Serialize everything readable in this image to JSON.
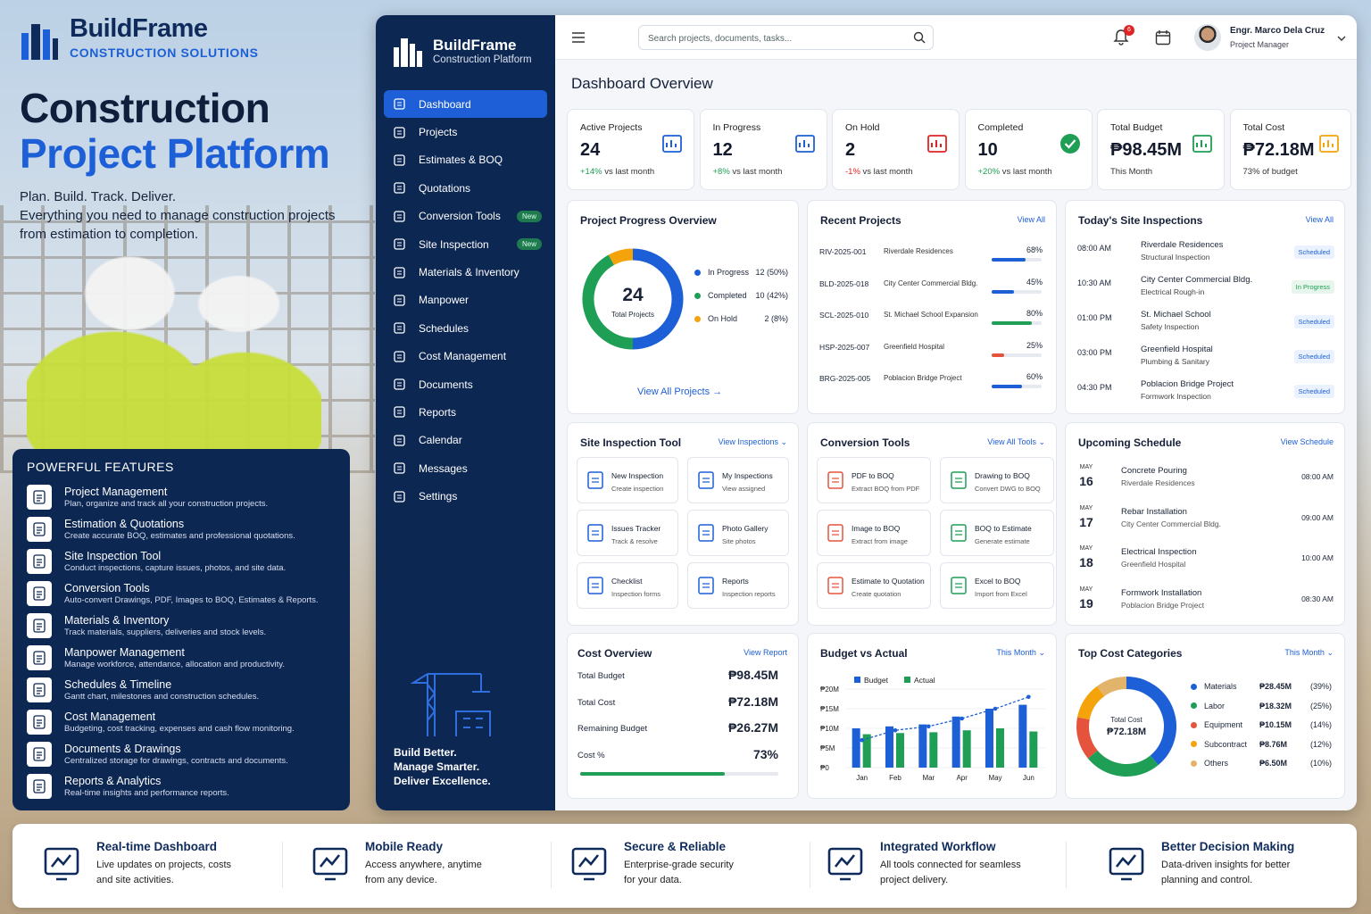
{
  "brand": {
    "name": "BuildFrame",
    "tagline": "CONSTRUCTION SOLUTIONS"
  },
  "hero": {
    "line1": "Construction",
    "line2": "Project Platform",
    "tag": "Plan. Build. Track. Deliver.",
    "desc": "Everything you need to manage construction projects from estimation to completion."
  },
  "features": {
    "title": "POWERFUL FEATURES",
    "items": [
      {
        "title": "Project Management",
        "desc": "Plan, organize and track all your construction projects."
      },
      {
        "title": "Estimation & Quotations",
        "desc": "Create accurate BOQ, estimates and professional quotations."
      },
      {
        "title": "Site Inspection Tool",
        "desc": "Conduct inspections, capture issues, photos, and site data."
      },
      {
        "title": "Conversion Tools",
        "desc": "Auto-convert Drawings, PDF, Images to BOQ, Estimates & Reports."
      },
      {
        "title": "Materials & Inventory",
        "desc": "Track materials, suppliers, deliveries and stock levels."
      },
      {
        "title": "Manpower Management",
        "desc": "Manage workforce, attendance, allocation and productivity."
      },
      {
        "title": "Schedules & Timeline",
        "desc": "Gantt chart, milestones and construction schedules."
      },
      {
        "title": "Cost Management",
        "desc": "Budgeting, cost tracking, expenses and cash flow monitoring."
      },
      {
        "title": "Documents & Drawings",
        "desc": "Centralized storage for drawings, contracts and documents."
      },
      {
        "title": "Reports & Analytics",
        "desc": "Real-time insights and performance reports."
      }
    ]
  },
  "sidebar": {
    "title": "BuildFrame",
    "subtitle": "Construction Platform",
    "badge": "New",
    "items": [
      {
        "label": "Dashboard",
        "icon": "home-icon"
      },
      {
        "label": "Projects",
        "icon": "folder-icon"
      },
      {
        "label": "Estimates & BOQ",
        "icon": "calculator-icon"
      },
      {
        "label": "Quotations",
        "icon": "document-icon"
      },
      {
        "label": "Conversion Tools",
        "icon": "convert-icon"
      },
      {
        "label": "Site Inspection",
        "icon": "clipboard-icon"
      },
      {
        "label": "Materials & Inventory",
        "icon": "box-icon"
      },
      {
        "label": "Manpower",
        "icon": "users-icon"
      },
      {
        "label": "Schedules",
        "icon": "calendar-icon"
      },
      {
        "label": "Cost Management",
        "icon": "coins-icon"
      },
      {
        "label": "Documents",
        "icon": "file-icon"
      },
      {
        "label": "Reports",
        "icon": "chart-icon"
      },
      {
        "label": "Calendar",
        "icon": "calendar-icon"
      },
      {
        "label": "Messages",
        "icon": "message-icon"
      },
      {
        "label": "Settings",
        "icon": "gear-icon"
      }
    ],
    "footer": [
      "Build Better.",
      "Manage Smarter.",
      "Deliver Excellence."
    ]
  },
  "topbar": {
    "search_placeholder": "Search projects, documents, tasks...",
    "notifications": "6",
    "user_name": "Engr. Marco Dela Cruz",
    "user_role": "Project Manager"
  },
  "page_title": "Dashboard Overview",
  "kpis": [
    {
      "label": "Active Projects",
      "value": "24",
      "delta": "+14%",
      "suffix": "vs last month",
      "tone": "green"
    },
    {
      "label": "In Progress",
      "value": "12",
      "delta": "+8%",
      "suffix": "vs last month",
      "tone": "green"
    },
    {
      "label": "On Hold",
      "value": "2",
      "delta": "-1%",
      "suffix": "vs last month",
      "tone": "red"
    },
    {
      "label": "Completed",
      "value": "10",
      "delta": "+20%",
      "suffix": "vs last month",
      "tone": "green"
    },
    {
      "label": "Total Budget",
      "value": "₱98.45M",
      "delta": "",
      "suffix": "This Month",
      "tone": ""
    },
    {
      "label": "Total Cost",
      "value": "₱72.18M",
      "delta": "",
      "suffix": "73% of budget",
      "tone": ""
    }
  ],
  "progress": {
    "title": "Project Progress Overview",
    "center_value": "24",
    "center_label": "Total Projects",
    "link": "View All Projects →",
    "legend": [
      {
        "label": "In Progress",
        "value": "12 (50%)",
        "color": "#1d5fd6"
      },
      {
        "label": "Completed",
        "value": "10 (42%)",
        "color": "#1f9e55"
      },
      {
        "label": "On Hold",
        "value": "2 (8%)",
        "color": "#f5a30a"
      }
    ]
  },
  "recent": {
    "title": "Recent Projects",
    "link": "View All",
    "rows": [
      {
        "code": "RIV-2025-001",
        "name": "Riverdale Residences",
        "pct": "68%",
        "frac": 0.68,
        "color": "#1d5fd6"
      },
      {
        "code": "BLD-2025-018",
        "name": "City Center Commercial Bldg.",
        "pct": "45%",
        "frac": 0.45,
        "color": "#1d5fd6"
      },
      {
        "code": "SCL-2025-010",
        "name": "St. Michael School Expansion",
        "pct": "80%",
        "frac": 0.8,
        "color": "#1f9e55"
      },
      {
        "code": "HSP-2025-007",
        "name": "Greenfield Hospital",
        "pct": "25%",
        "frac": 0.25,
        "color": "#e5533d"
      },
      {
        "code": "BRG-2025-005",
        "name": "Poblacion Bridge Project",
        "pct": "60%",
        "frac": 0.6,
        "color": "#1d5fd6"
      }
    ]
  },
  "inspections": {
    "title": "Today's Site Inspections",
    "link": "View All",
    "rows": [
      {
        "time": "08:00 AM",
        "name": "Riverdale Residences",
        "type": "Structural Inspection",
        "status": "Scheduled",
        "green": false
      },
      {
        "time": "10:30 AM",
        "name": "City Center Commercial Bldg.",
        "type": "Electrical Rough-in",
        "status": "In Progress",
        "green": true
      },
      {
        "time": "01:00 PM",
        "name": "St. Michael School",
        "type": "Safety Inspection",
        "status": "Scheduled",
        "green": false
      },
      {
        "time": "03:00 PM",
        "name": "Greenfield Hospital",
        "type": "Plumbing & Sanitary",
        "status": "Scheduled",
        "green": false
      },
      {
        "time": "04:30 PM",
        "name": "Poblacion Bridge Project",
        "type": "Formwork Inspection",
        "status": "Scheduled",
        "green": false
      }
    ]
  },
  "site_tool": {
    "title": "Site Inspection Tool",
    "link": "View Inspections",
    "tiles": [
      {
        "title": "New Inspection",
        "desc": "Create inspection"
      },
      {
        "title": "My Inspections",
        "desc": "View assigned"
      },
      {
        "title": "Issues Tracker",
        "desc": "Track & resolve"
      },
      {
        "title": "Photo Gallery",
        "desc": "Site photos"
      },
      {
        "title": "Checklist",
        "desc": "Inspection forms"
      },
      {
        "title": "Reports",
        "desc": "Inspection reports"
      }
    ]
  },
  "conversion": {
    "title": "Conversion Tools",
    "link": "View All Tools",
    "tiles": [
      {
        "title": "PDF to BOQ",
        "desc": "Extract BOQ from PDF"
      },
      {
        "title": "Drawing to BOQ",
        "desc": "Convert DWG to BOQ"
      },
      {
        "title": "Image to BOQ",
        "desc": "Extract from image"
      },
      {
        "title": "BOQ to Estimate",
        "desc": "Generate estimate"
      },
      {
        "title": "Estimate to Quotation",
        "desc": "Create quotation"
      },
      {
        "title": "Excel to BOQ",
        "desc": "Import from Excel"
      }
    ]
  },
  "schedule": {
    "title": "Upcoming Schedule",
    "link": "View Schedule",
    "rows": [
      {
        "month": "MAY",
        "day": "16",
        "name": "Concrete Pouring",
        "loc": "Riverdale Residences",
        "time": "08:00 AM"
      },
      {
        "month": "MAY",
        "day": "17",
        "name": "Rebar Installation",
        "loc": "City Center Commercial Bldg.",
        "time": "09:00 AM"
      },
      {
        "month": "MAY",
        "day": "18",
        "name": "Electrical Inspection",
        "loc": "Greenfield Hospital",
        "time": "10:00 AM"
      },
      {
        "month": "MAY",
        "day": "19",
        "name": "Formwork Installation",
        "loc": "Poblacion Bridge Project",
        "time": "08:30 AM"
      }
    ]
  },
  "cost": {
    "title": "Cost Overview",
    "link": "View Report",
    "rows": [
      {
        "label": "Total Budget",
        "value": "₱98.45M"
      },
      {
        "label": "Total Cost",
        "value": "₱72.18M"
      },
      {
        "label": "Remaining Budget",
        "value": "₱26.27M"
      },
      {
        "label": "Cost %",
        "value": "73%"
      }
    ],
    "progress": 0.73
  },
  "budget": {
    "title": "Budget vs Actual",
    "filter": "This Month"
  },
  "top_cost": {
    "title": "Top Cost Categories",
    "filter": "This Month",
    "center_label": "Total Cost",
    "center_value": "₱72.18M"
  },
  "chart_data": [
    {
      "type": "bar",
      "title": "Budget vs Actual",
      "categories": [
        "Jan",
        "Feb",
        "Mar",
        "Apr",
        "May",
        "Jun"
      ],
      "series": [
        {
          "name": "Budget",
          "values": [
            10,
            10.5,
            11,
            13,
            15,
            16
          ]
        },
        {
          "name": "Actual",
          "values": [
            8.5,
            8.8,
            9,
            9.5,
            10,
            9.2
          ]
        }
      ],
      "yticks": [
        "₱0",
        "₱5M",
        "₱10M",
        "₱15M",
        "₱20M"
      ],
      "ylim": [
        0,
        20
      ],
      "trend": [
        7,
        9.5,
        10.5,
        12.5,
        15,
        18
      ],
      "legend": "top-left",
      "colors": [
        "#1d5fd6",
        "#1f9e55"
      ]
    },
    {
      "type": "pie",
      "title": "Top Cost Categories",
      "slices": [
        {
          "label": "Materials",
          "value": "₱28.45M",
          "pct": "(39%)",
          "frac": 0.39,
          "color": "#1d5fd6"
        },
        {
          "label": "Labor",
          "value": "₱18.32M",
          "pct": "(25%)",
          "frac": 0.25,
          "color": "#1f9e55"
        },
        {
          "label": "Equipment",
          "value": "₱10.15M",
          "pct": "(14%)",
          "frac": 0.14,
          "color": "#e5533d"
        },
        {
          "label": "Subcontract",
          "value": "₱8.76M",
          "pct": "(12%)",
          "frac": 0.12,
          "color": "#f5a30a"
        },
        {
          "label": "Others",
          "value": "₱6.50M",
          "pct": "(10%)",
          "frac": 0.1,
          "color": "#e2b36b"
        }
      ]
    },
    {
      "type": "pie",
      "title": "Project Progress Overview",
      "slices": [
        {
          "label": "In Progress",
          "frac": 0.5,
          "color": "#1d5fd6"
        },
        {
          "label": "Completed",
          "frac": 0.42,
          "color": "#1f9e55"
        },
        {
          "label": "On Hold",
          "frac": 0.08,
          "color": "#f5a30a"
        }
      ]
    }
  ],
  "strip": [
    {
      "title": "Real-time Dashboard",
      "desc": [
        "Live updates on projects, costs",
        "and site activities."
      ]
    },
    {
      "title": "Mobile Ready",
      "desc": [
        "Access anywhere, anytime",
        "from any device."
      ]
    },
    {
      "title": "Secure & Reliable",
      "desc": [
        "Enterprise-grade security",
        "for your data."
      ]
    },
    {
      "title": "Integrated Workflow",
      "desc": [
        "All tools connected for seamless",
        "project delivery."
      ]
    },
    {
      "title": "Better Decision Making",
      "desc": [
        "Data-driven insights for better",
        "planning and control."
      ]
    }
  ]
}
